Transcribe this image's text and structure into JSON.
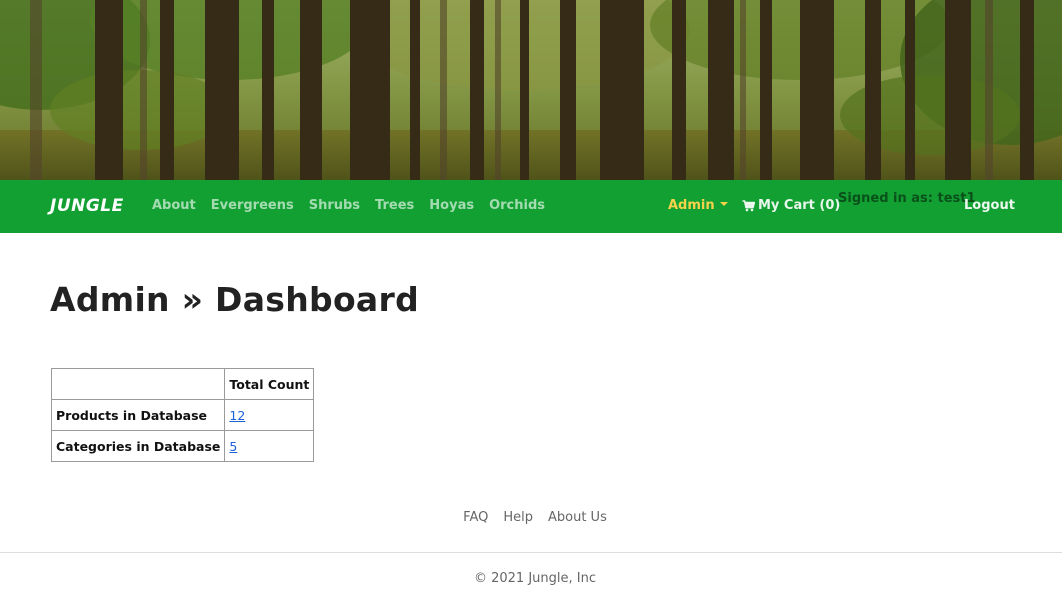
{
  "navbar": {
    "brand": "JUNGLE",
    "links": [
      "About",
      "Evergreens",
      "Shrubs",
      "Trees",
      "Hoyas",
      "Orchids"
    ],
    "admin_label": "Admin",
    "cart_label": "My Cart (0)",
    "signed_in_text": "Signed in as: test1",
    "logout_label": "Logout"
  },
  "main": {
    "title": "Admin » Dashboard",
    "table": {
      "header": "Total Count",
      "rows": [
        {
          "label": "Products in Database",
          "value": "12"
        },
        {
          "label": "Categories in Database",
          "value": "5"
        }
      ]
    }
  },
  "footer": {
    "links": [
      "FAQ",
      "Help",
      "About Us"
    ],
    "copyright": "© 2021 Jungle, Inc"
  },
  "colors": {
    "navbar_bg": "#12a033",
    "admin_accent": "#f7d24b",
    "link_blue": "#1a62d8"
  },
  "icons": {
    "cart": "shopping-cart-icon",
    "admin_dropdown": "caret-down-icon"
  }
}
